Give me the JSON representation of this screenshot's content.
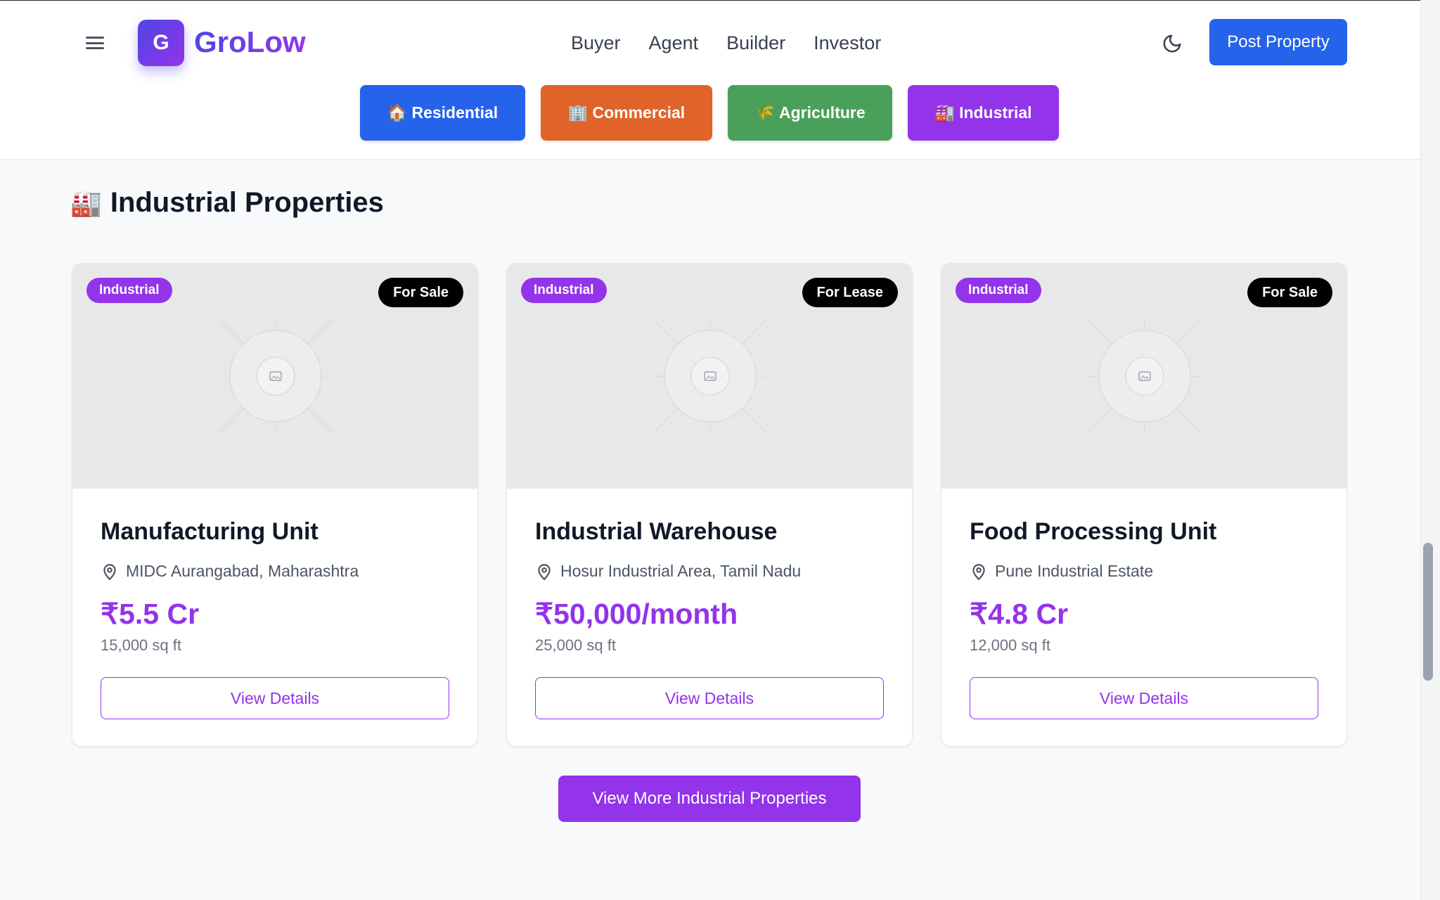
{
  "header": {
    "logo_letter": "G",
    "brand": "GroLow",
    "nav": [
      "Buyer",
      "Agent",
      "Builder",
      "Investor"
    ],
    "post_label": "Post Property"
  },
  "categories": [
    {
      "icon": "🏠",
      "label": "Residential",
      "color": "#2563eb"
    },
    {
      "icon": "🏢",
      "label": "Commercial",
      "color": "#e0632a"
    },
    {
      "icon": "🌾",
      "label": "Agriculture",
      "color": "#4aa05a"
    },
    {
      "icon": "🏭",
      "label": "Industrial",
      "color": "#9333ea"
    }
  ],
  "section": {
    "icon": "🏭",
    "title": "Industrial Properties"
  },
  "properties": [
    {
      "type": "Industrial",
      "status": "For Sale",
      "title": "Manufacturing Unit",
      "location": "MIDC Aurangabad, Maharashtra",
      "price": "₹5.5 Cr",
      "area": "15,000 sq ft",
      "cta": "View Details"
    },
    {
      "type": "Industrial",
      "status": "For Lease",
      "title": "Industrial Warehouse",
      "location": "Hosur Industrial Area, Tamil Nadu",
      "price": "₹50,000/month",
      "area": "25,000 sq ft",
      "cta": "View Details"
    },
    {
      "type": "Industrial",
      "status": "For Sale",
      "title": "Food Processing Unit",
      "location": "Pune Industrial Estate",
      "price": "₹4.8 Cr",
      "area": "12,000 sq ft",
      "cta": "View Details"
    }
  ],
  "more_label": "View More Industrial Properties",
  "colors": {
    "accent": "#9333ea",
    "primary": "#2563eb"
  },
  "icons": {
    "menu": "hamburger-icon",
    "theme": "moon-icon",
    "location": "map-pin-icon",
    "placeholder": "image-placeholder-icon"
  }
}
